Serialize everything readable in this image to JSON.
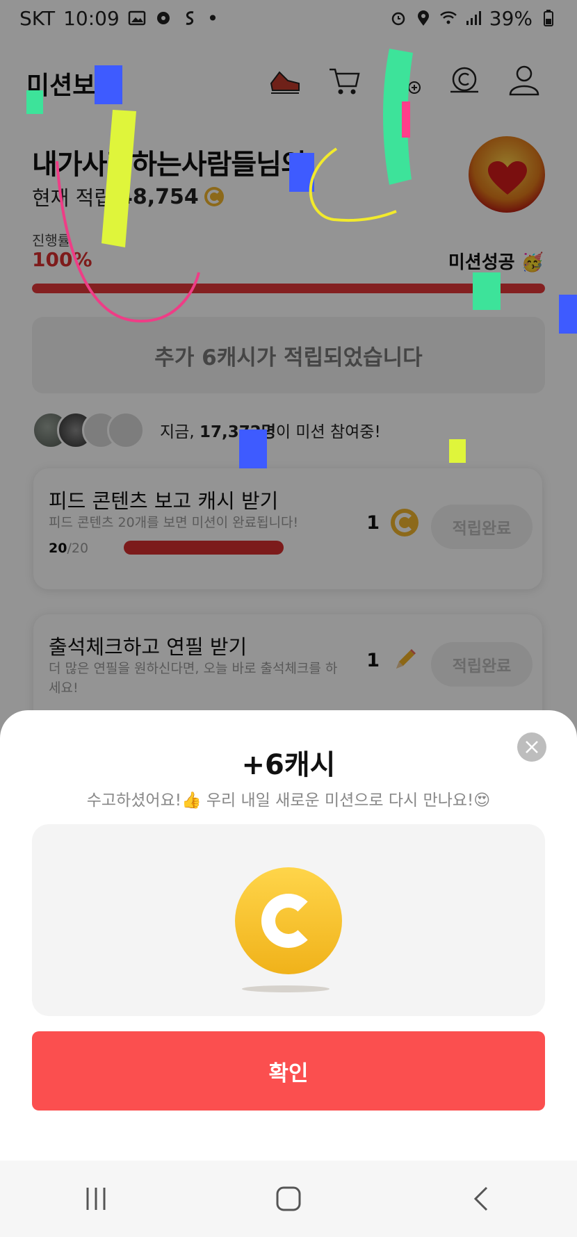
{
  "status_bar": {
    "carrier": "SKT",
    "time": "10:09",
    "dot": "•",
    "battery": "39%",
    "icons": [
      "gallery-icon",
      "settings-icon",
      "s-icon",
      "alarm-icon",
      "location-icon",
      "wifi-icon",
      "signal-icon",
      "battery-icon"
    ]
  },
  "app": {
    "title": "미션보",
    "top_icons": [
      "shoe-icon",
      "cart-icon",
      "add-friend-icon",
      "coin-stack-icon",
      "profile-icon"
    ]
  },
  "header": {
    "headline": "내가사랑하는사람들님의",
    "cash_label": "현재 적립",
    "cash_value": "48,754"
  },
  "progress": {
    "label": "진행률",
    "percent_text": "100%",
    "percent_value": 1.0,
    "success_text": "미션성공 🥳"
  },
  "notice": "추가 6캐시가 적립되었습니다",
  "participants": {
    "prefix": "지금,",
    "count": "17,372명",
    "suffix": "이 미션 참여중!"
  },
  "missions": [
    {
      "title": "피드 콘텐츠 보고 캐시 받기",
      "description": "피드 콘텐츠 20개를 보면 미션이 완료됩니다!",
      "count_done": "20",
      "count_total": "/20",
      "reward": "1",
      "button": "적립완료"
    },
    {
      "title": "출석체크하고 연필 받기",
      "description": "더 많은 연필을 원하신다면, 오늘 바로 출석체크를 하세요!",
      "reward": "1",
      "button": "적립완료"
    }
  ],
  "sheet": {
    "title": "+6캐시",
    "subtitle": "수고하셨어요!👍 우리 내일 새로운 미션으로 다시 만나요!😍",
    "confirm": "확인"
  },
  "colors": {
    "accent_red": "#fb4f4f",
    "progress_red": "#e4383a",
    "coin_gold": "#f1b62e"
  }
}
